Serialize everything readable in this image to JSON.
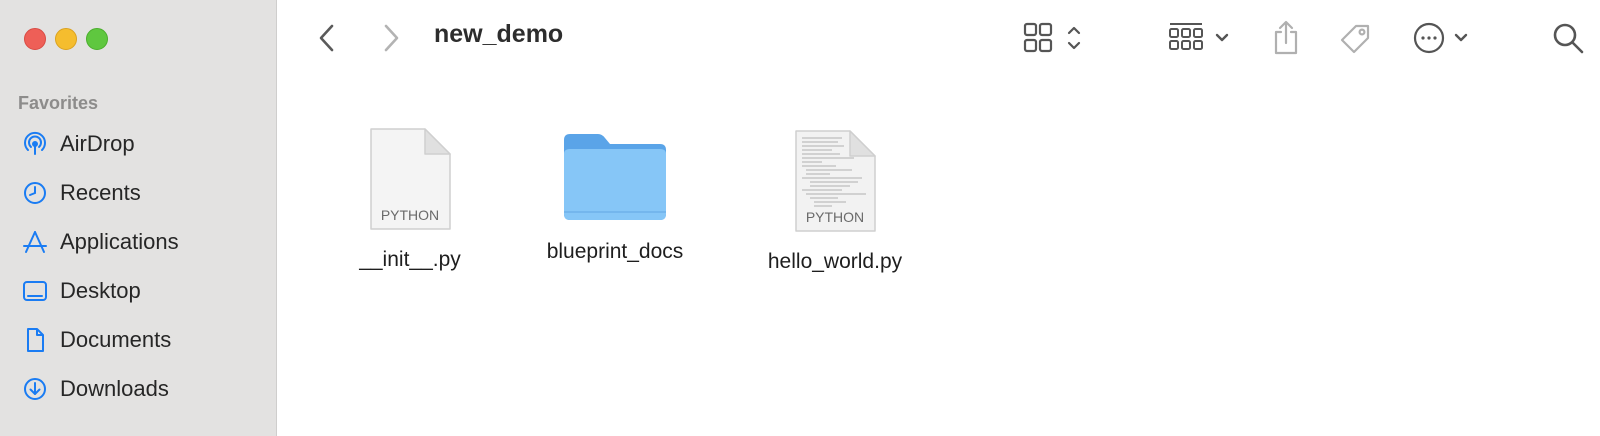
{
  "window": {
    "title": "new_demo"
  },
  "sidebar": {
    "section_favorites": "Favorites",
    "items": [
      {
        "label": "AirDrop",
        "icon": "airdrop-icon"
      },
      {
        "label": "Recents",
        "icon": "clock-icon"
      },
      {
        "label": "Applications",
        "icon": "applications-icon"
      },
      {
        "label": "Desktop",
        "icon": "desktop-icon"
      },
      {
        "label": "Documents",
        "icon": "document-icon"
      },
      {
        "label": "Downloads",
        "icon": "download-icon"
      }
    ]
  },
  "files": [
    {
      "name": "__init__.py",
      "kind_label": "PYTHON"
    },
    {
      "name": "blueprint_docs",
      "kind_label": ""
    },
    {
      "name": "hello_world.py",
      "kind_label": "PYTHON"
    }
  ],
  "colors": {
    "accent": "#1a7cf3",
    "folder": "#7cc1f6"
  }
}
